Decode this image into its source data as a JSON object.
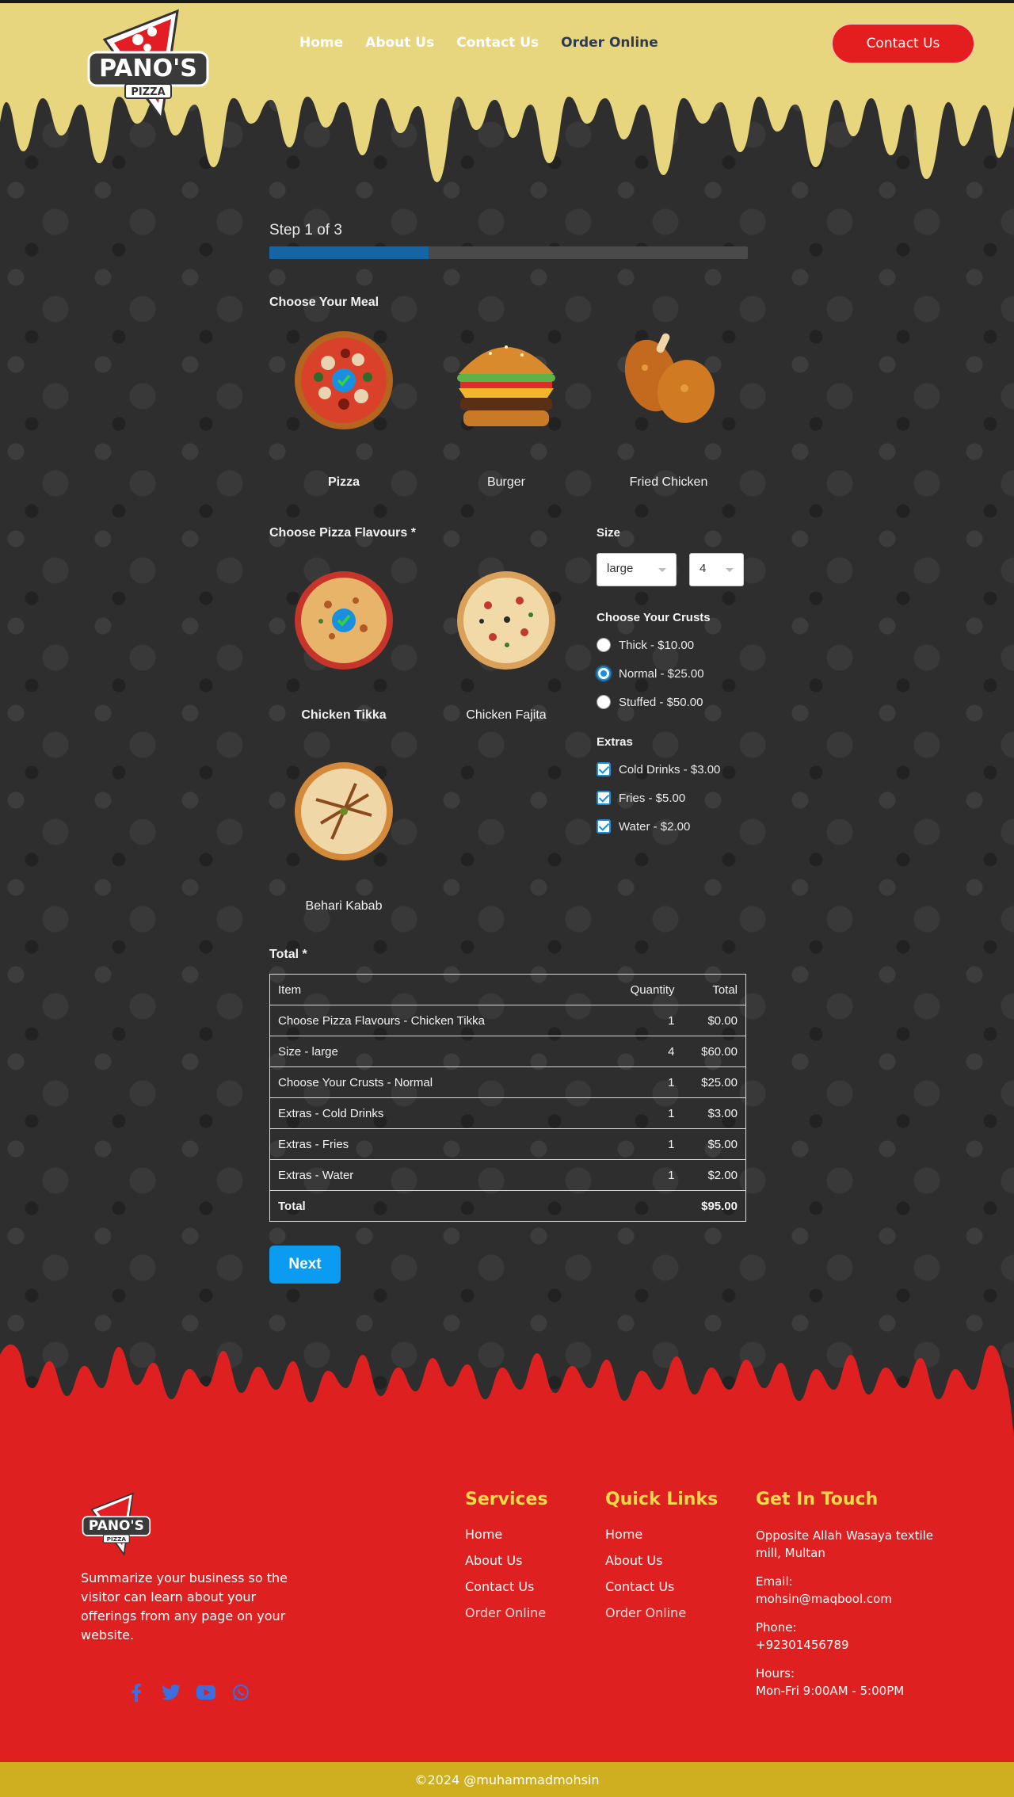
{
  "header": {
    "logo_text": "PANO'S",
    "logo_subtext": "PIZZA",
    "nav": [
      {
        "label": "Home"
      },
      {
        "label": "About Us"
      },
      {
        "label": "Contact Us"
      },
      {
        "label": "Order Online"
      }
    ],
    "cta_label": "Contact Us",
    "colors": {
      "cheese": "#e7d67d",
      "cta": "#e41e1e",
      "active_nav": "#2f3a56"
    }
  },
  "form": {
    "step_label": "Step 1 of 3",
    "progress_fraction": 0.333,
    "meal_title": "Choose Your Meal",
    "meals": [
      {
        "label": "Pizza",
        "selected": true
      },
      {
        "label": "Burger",
        "selected": false
      },
      {
        "label": "Fried Chicken",
        "selected": false
      }
    ],
    "flavours_title": "Choose Pizza Flavours *",
    "flavours": [
      {
        "label": "Chicken Tikka",
        "selected": true
      },
      {
        "label": "Chicken Fajita",
        "selected": false
      },
      {
        "label": "Behari Kabab",
        "selected": false
      }
    ],
    "size_title": "Size",
    "size_value": "large",
    "quantity_value": "4",
    "crusts_title": "Choose Your Crusts",
    "crusts": [
      {
        "label": "Thick - $10.00",
        "selected": false
      },
      {
        "label": "Normal - $25.00",
        "selected": true
      },
      {
        "label": "Stuffed - $50.00",
        "selected": false
      }
    ],
    "extras_title": "Extras",
    "extras": [
      {
        "label": "Cold Drinks - $3.00",
        "checked": true
      },
      {
        "label": "Fries - $5.00",
        "checked": true
      },
      {
        "label": "Water - $2.00",
        "checked": true
      }
    ],
    "total_title": "Total *",
    "table": {
      "headers": [
        "Item",
        "Quantity",
        "Total"
      ],
      "rows": [
        [
          "Choose Pizza Flavours - Chicken Tikka",
          "1",
          "$0.00"
        ],
        [
          "Size - large",
          "4",
          "$60.00"
        ],
        [
          "Choose Your Crusts - Normal",
          "1",
          "$25.00"
        ],
        [
          "Extras - Cold Drinks",
          "1",
          "$3.00"
        ],
        [
          "Extras - Fries",
          "1",
          "$5.00"
        ],
        [
          "Extras - Water",
          "1",
          "$2.00"
        ]
      ],
      "total_label": "Total",
      "total_value": "$95.00"
    },
    "next_label": "Next"
  },
  "footer": {
    "description": "Summarize your business so the visitor can learn about your offerings from any page on your website.",
    "services_title": "Services",
    "services": [
      "Home",
      "About Us",
      "Contact Us",
      "Order Online"
    ],
    "quick_title": "Quick Links",
    "quick_links": [
      "Home",
      "About Us",
      "Contact Us",
      "Order Online"
    ],
    "touch_title": "Get In Touch",
    "address": "Opposite Allah Wasaya textile mill, Multan",
    "email_label": "Email:",
    "email": "mohsin@maqbool.com",
    "phone_label": "Phone:",
    "phone": "+92301456789",
    "hours_label": "Hours:",
    "hours": "Mon-Fri 9:00AM - 5:00PM",
    "social_icons": [
      "facebook-icon",
      "twitter-icon",
      "youtube-icon",
      "whatsapp-icon"
    ],
    "copyright": "©2024 @muhammadmohsin",
    "colors": {
      "red": "#df2020",
      "gold": "#cfae20",
      "heading": "#f4d94a"
    }
  }
}
